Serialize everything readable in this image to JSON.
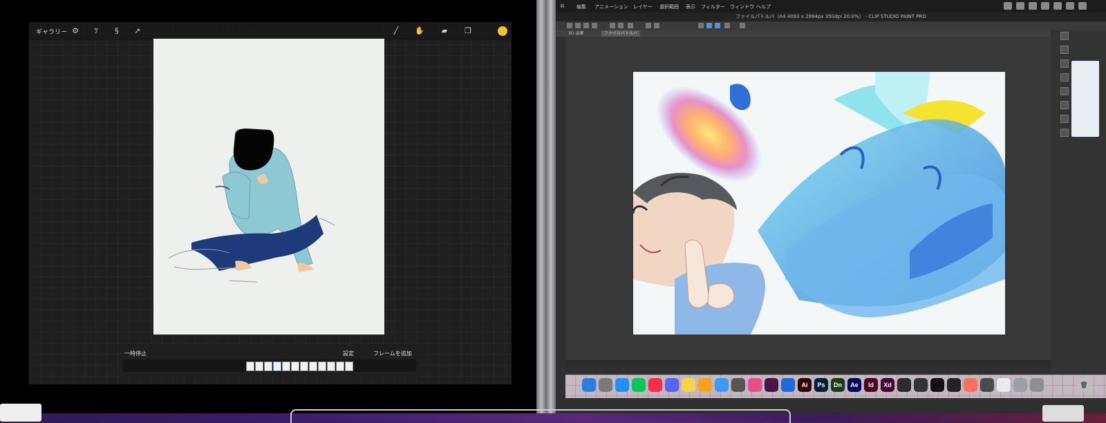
{
  "left_app": {
    "toolbar": {
      "gallery_label": "ギャラリー",
      "tool_icons": [
        "wrench-icon",
        "wand-icon",
        "selection-s-icon",
        "arrow-cursor-icon"
      ],
      "right_tools": [
        "brush-icon",
        "smudge-icon",
        "eraser-icon",
        "layers-icon"
      ],
      "active_color": "#f1c232"
    },
    "animation": {
      "pause_label": "一時停止",
      "settings_label": "設定",
      "add_frame_label": "フレームを追加",
      "frame_count": 12,
      "active_frame": 3
    }
  },
  "right_app": {
    "menubar": {
      "items": [
        "編集",
        "アニメーション",
        "レイヤー",
        "選択範囲",
        "表示",
        "フィルター",
        "ウィンドウ",
        "ヘルプ"
      ]
    },
    "window_title": "ファイルパトルバ（A4 4093 x 2894px 350dpi 20.0%） - CLIP STUDIO PAINT PRO",
    "tabs": [
      "3D 出確",
      "ファイルパトルバ"
    ],
    "dock_apps": [
      {
        "label": "",
        "color": "#2a7de1"
      },
      {
        "label": "",
        "color": "#7a7a7a"
      },
      {
        "label": "",
        "color": "#1e90ff"
      },
      {
        "label": "",
        "color": "#06c755"
      },
      {
        "label": "",
        "color": "#fa2d48"
      },
      {
        "label": "",
        "color": "#5865f2"
      },
      {
        "label": "",
        "color": "#f5d547"
      },
      {
        "label": "",
        "color": "#f7a21b"
      },
      {
        "label": "",
        "color": "#3d9bff"
      },
      {
        "label": "",
        "color": "#555555"
      },
      {
        "label": "",
        "color": "#e74c8b"
      },
      {
        "label": "",
        "color": "#4a154b"
      },
      {
        "label": "",
        "color": "#1e6bd6"
      },
      {
        "label": "Ai",
        "color": "#330000"
      },
      {
        "label": "Ps",
        "color": "#001e36"
      },
      {
        "label": "Dn",
        "color": "#1a3c1a"
      },
      {
        "label": "Ae",
        "color": "#00005b"
      },
      {
        "label": "Id",
        "color": "#49021f"
      },
      {
        "label": "Xd",
        "color": "#470137"
      },
      {
        "label": "",
        "color": "#2b2b2b"
      },
      {
        "label": "",
        "color": "#333333"
      },
      {
        "label": "",
        "color": "#111111"
      },
      {
        "label": "",
        "color": "#222222"
      },
      {
        "label": "",
        "color": "#ff6f61"
      },
      {
        "label": "",
        "color": "#4a4a4a"
      },
      {
        "label": "",
        "color": "#e8eaed"
      },
      {
        "label": "",
        "color": "#9aa0a6"
      },
      {
        "label": "",
        "color": "#8e8e93"
      }
    ]
  }
}
